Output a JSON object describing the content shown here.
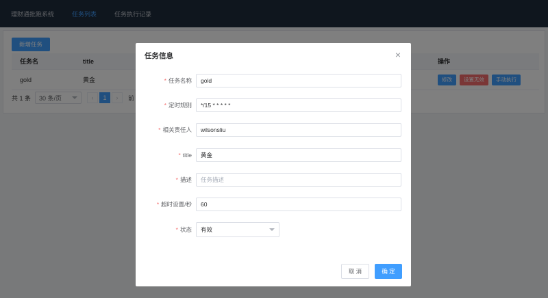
{
  "nav": {
    "items": [
      {
        "label": "理财通批跑系统",
        "active": false
      },
      {
        "label": "任务列表",
        "active": true
      },
      {
        "label": "任务执行记录",
        "active": false
      }
    ]
  },
  "page": {
    "add_button": "新增任务",
    "table": {
      "headers": {
        "name": "任务名",
        "title": "title",
        "ops": "操作"
      },
      "rows": [
        {
          "name": "gold",
          "title": "黄金",
          "ops": {
            "edit": "修改",
            "invalid": "设置无效",
            "run": "手动执行"
          }
        }
      ]
    },
    "pager": {
      "total": "共 1 条",
      "page_size": "30 条/页",
      "prev": "‹",
      "current": "1",
      "next": "›",
      "jump": "前"
    }
  },
  "modal": {
    "title": "任务信息",
    "close_icon": "×",
    "fields": [
      {
        "label": "任务名称",
        "value": "gold",
        "placeholder": ""
      },
      {
        "label": "定时规则",
        "value": "*/15 * * * * *",
        "placeholder": ""
      },
      {
        "label": "相关责任人",
        "value": "wilsonsliu",
        "placeholder": ""
      },
      {
        "label": "title",
        "value": "黄金",
        "placeholder": ""
      },
      {
        "label": "描述",
        "value": "",
        "placeholder": "任务描述"
      },
      {
        "label": "超时设置/秒",
        "value": "60",
        "placeholder": ""
      }
    ],
    "status": {
      "label": "状态",
      "value": "有效"
    },
    "required_mark": "*",
    "cancel_label": "取 消",
    "ok_label": "确 定"
  },
  "colors": {
    "primary": "#409eff",
    "danger": "#f56c6c",
    "nav_bg": "#1f2d3d"
  }
}
